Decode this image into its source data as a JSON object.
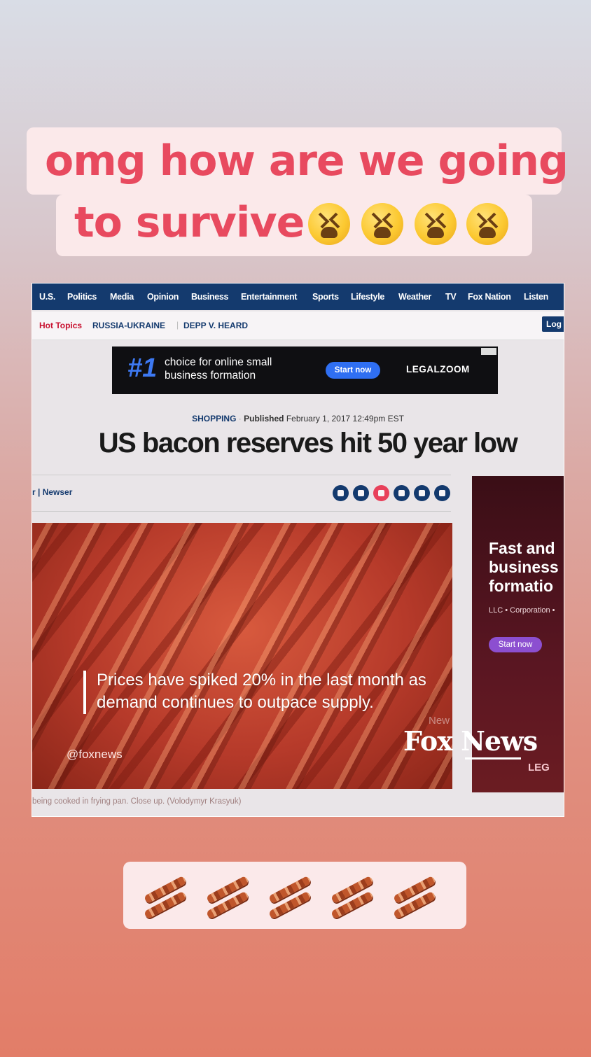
{
  "caption": {
    "line1": "omg how are we going",
    "line2": "to survive",
    "emoji_count": 4,
    "emoji_icon": "tired-face-emoji",
    "text_color": "#e84a5f"
  },
  "screenshot": {
    "nav": [
      "U.S.",
      "Politics",
      "Media",
      "Opinion",
      "Business",
      "Entertainment",
      "Sports",
      "Lifestyle",
      "Weather",
      "TV",
      "Fox Nation",
      "Listen"
    ],
    "hot_topics_label": "Hot Topics",
    "hot_topics": [
      "RUSSIA-UKRAINE",
      "DEPP V. HEARD"
    ],
    "login_label": "Log",
    "ad": {
      "number": "#1",
      "text": "choice for online small business formation",
      "button": "Start now",
      "brand": "LEGALZOOM"
    },
    "category": "SHOPPING",
    "published_label": "Published",
    "published_date": "February 1, 2017 12:49pm EST",
    "headline": "US bacon reserves hit 50 year low",
    "byline": "r | Newser",
    "photo_caption": "being cooked in frying pan. Close up. (Volodymyr Krasyuk)",
    "sidebar_ad": {
      "headline_lines": [
        "Fast and",
        "business",
        "formatio"
      ],
      "subtext": "LLC • Corporation •",
      "button": "Start now",
      "brand": "LEG"
    }
  },
  "overlay": {
    "quote_line1": "Prices have spiked 20% in the last month as",
    "quote_line2": "demand continues to outpace supply.",
    "handle": "@foxnews",
    "faint_news": "New",
    "logo_text": "Fox News"
  },
  "bacon_row": {
    "count": 5,
    "icon": "bacon-emoji"
  }
}
